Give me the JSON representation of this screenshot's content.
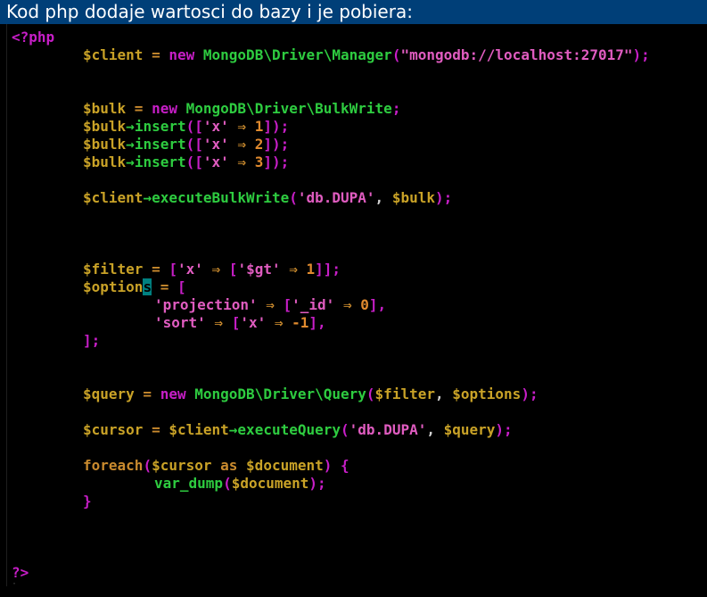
{
  "window": {
    "title": "Kod php dodaje wartosci do bazy i je pobiera:"
  },
  "colors": {
    "title_bar_bg": "#003f78",
    "editor_bg": "#000000",
    "variable": "#c9a227",
    "keyword": "#c71ec7",
    "class_name": "#2ecc40",
    "method": "#2ecc40",
    "string": "#e05cc0",
    "number": "#e08a2e",
    "operator": "#c98a2e",
    "punctuation": "#c71ec7",
    "arrow": "#2ecc40",
    "default": "#d0d0d0",
    "cursor": "#008080"
  },
  "cursor": {
    "line": 13,
    "char": "s"
  },
  "code_lines": [
    {
      "row": 0,
      "indent": 0,
      "tokens": [
        {
          "text": "<?php",
          "kind": "keyword"
        }
      ]
    },
    {
      "row": 1,
      "indent": 8,
      "tokens": [
        {
          "text": "$client",
          "kind": "variable"
        },
        {
          "text": " = ",
          "kind": "operator"
        },
        {
          "text": "new",
          "kind": "keyword"
        },
        {
          "text": " ",
          "kind": "default"
        },
        {
          "text": "MongoDB\\Driver\\Manager",
          "kind": "class_name"
        },
        {
          "text": "(",
          "kind": "punctuation"
        },
        {
          "text": "\"mongodb://localhost:27017\"",
          "kind": "string"
        },
        {
          "text": ");",
          "kind": "punctuation"
        }
      ]
    },
    {
      "row": 4,
      "indent": 8,
      "tokens": [
        {
          "text": "$bulk",
          "kind": "variable"
        },
        {
          "text": " = ",
          "kind": "operator"
        },
        {
          "text": "new",
          "kind": "keyword"
        },
        {
          "text": " ",
          "kind": "default"
        },
        {
          "text": "MongoDB\\Driver\\BulkWrite",
          "kind": "class_name"
        },
        {
          "text": ";",
          "kind": "punctuation"
        }
      ]
    },
    {
      "row": 5,
      "indent": 8,
      "tokens": [
        {
          "text": "$bulk",
          "kind": "variable"
        },
        {
          "text": "→",
          "kind": "arrow"
        },
        {
          "text": "insert",
          "kind": "method"
        },
        {
          "text": "([",
          "kind": "punctuation"
        },
        {
          "text": "'x'",
          "kind": "string"
        },
        {
          "text": " ⇒ ",
          "kind": "operator"
        },
        {
          "text": "1",
          "kind": "number"
        },
        {
          "text": "]);",
          "kind": "punctuation"
        }
      ]
    },
    {
      "row": 6,
      "indent": 8,
      "tokens": [
        {
          "text": "$bulk",
          "kind": "variable"
        },
        {
          "text": "→",
          "kind": "arrow"
        },
        {
          "text": "insert",
          "kind": "method"
        },
        {
          "text": "([",
          "kind": "punctuation"
        },
        {
          "text": "'x'",
          "kind": "string"
        },
        {
          "text": " ⇒ ",
          "kind": "operator"
        },
        {
          "text": "2",
          "kind": "number"
        },
        {
          "text": "]);",
          "kind": "punctuation"
        }
      ]
    },
    {
      "row": 7,
      "indent": 8,
      "tokens": [
        {
          "text": "$bulk",
          "kind": "variable"
        },
        {
          "text": "→",
          "kind": "arrow"
        },
        {
          "text": "insert",
          "kind": "method"
        },
        {
          "text": "([",
          "kind": "punctuation"
        },
        {
          "text": "'x'",
          "kind": "string"
        },
        {
          "text": " ⇒ ",
          "kind": "operator"
        },
        {
          "text": "3",
          "kind": "number"
        },
        {
          "text": "]);",
          "kind": "punctuation"
        }
      ]
    },
    {
      "row": 9,
      "indent": 8,
      "tokens": [
        {
          "text": "$client",
          "kind": "variable"
        },
        {
          "text": "→",
          "kind": "arrow"
        },
        {
          "text": "executeBulkWrite",
          "kind": "method"
        },
        {
          "text": "(",
          "kind": "punctuation"
        },
        {
          "text": "'db.DUPA'",
          "kind": "string"
        },
        {
          "text": ", ",
          "kind": "default"
        },
        {
          "text": "$bulk",
          "kind": "variable"
        },
        {
          "text": ");",
          "kind": "punctuation"
        }
      ]
    },
    {
      "row": 13,
      "indent": 8,
      "tokens": [
        {
          "text": "$filter",
          "kind": "variable"
        },
        {
          "text": " = ",
          "kind": "operator"
        },
        {
          "text": "[",
          "kind": "punctuation"
        },
        {
          "text": "'x'",
          "kind": "string"
        },
        {
          "text": " ⇒ ",
          "kind": "operator"
        },
        {
          "text": "[",
          "kind": "punctuation"
        },
        {
          "text": "'$gt'",
          "kind": "string"
        },
        {
          "text": " ⇒ ",
          "kind": "operator"
        },
        {
          "text": "1",
          "kind": "number"
        },
        {
          "text": "]];",
          "kind": "punctuation"
        }
      ]
    },
    {
      "row": 14,
      "indent": 8,
      "tokens": [
        {
          "text": "$option",
          "kind": "variable"
        },
        {
          "text": "s",
          "kind": "cursor"
        },
        {
          "text": " = ",
          "kind": "operator"
        },
        {
          "text": "[",
          "kind": "punctuation"
        }
      ]
    },
    {
      "row": 15,
      "indent": 16,
      "tokens": [
        {
          "text": "'projection'",
          "kind": "string"
        },
        {
          "text": " ⇒ ",
          "kind": "operator"
        },
        {
          "text": "[",
          "kind": "punctuation"
        },
        {
          "text": "'_id'",
          "kind": "string"
        },
        {
          "text": " ⇒ ",
          "kind": "operator"
        },
        {
          "text": "0",
          "kind": "number"
        },
        {
          "text": "],",
          "kind": "punctuation"
        }
      ]
    },
    {
      "row": 16,
      "indent": 16,
      "tokens": [
        {
          "text": "'sort'",
          "kind": "string"
        },
        {
          "text": " ⇒ ",
          "kind": "operator"
        },
        {
          "text": "[",
          "kind": "punctuation"
        },
        {
          "text": "'x'",
          "kind": "string"
        },
        {
          "text": " ⇒ ",
          "kind": "operator"
        },
        {
          "text": "-1",
          "kind": "number"
        },
        {
          "text": "],",
          "kind": "punctuation"
        }
      ]
    },
    {
      "row": 17,
      "indent": 8,
      "tokens": [
        {
          "text": "];",
          "kind": "punctuation"
        }
      ]
    },
    {
      "row": 20,
      "indent": 8,
      "tokens": [
        {
          "text": "$query",
          "kind": "variable"
        },
        {
          "text": " = ",
          "kind": "operator"
        },
        {
          "text": "new",
          "kind": "keyword"
        },
        {
          "text": " ",
          "kind": "default"
        },
        {
          "text": "MongoDB\\Driver\\Query",
          "kind": "class_name"
        },
        {
          "text": "(",
          "kind": "punctuation"
        },
        {
          "text": "$filter",
          "kind": "variable"
        },
        {
          "text": ", ",
          "kind": "default"
        },
        {
          "text": "$options",
          "kind": "variable"
        },
        {
          "text": ");",
          "kind": "punctuation"
        }
      ]
    },
    {
      "row": 22,
      "indent": 8,
      "tokens": [
        {
          "text": "$cursor",
          "kind": "variable"
        },
        {
          "text": " = ",
          "kind": "operator"
        },
        {
          "text": "$client",
          "kind": "variable"
        },
        {
          "text": "→",
          "kind": "arrow"
        },
        {
          "text": "executeQuery",
          "kind": "method"
        },
        {
          "text": "(",
          "kind": "punctuation"
        },
        {
          "text": "'db.DUPA'",
          "kind": "string"
        },
        {
          "text": ", ",
          "kind": "default"
        },
        {
          "text": "$query",
          "kind": "variable"
        },
        {
          "text": ");",
          "kind": "punctuation"
        }
      ]
    },
    {
      "row": 24,
      "indent": 8,
      "tokens": [
        {
          "text": "foreach",
          "kind": "operator"
        },
        {
          "text": "(",
          "kind": "punctuation"
        },
        {
          "text": "$cursor",
          "kind": "variable"
        },
        {
          "text": " as ",
          "kind": "operator"
        },
        {
          "text": "$document",
          "kind": "variable"
        },
        {
          "text": ")",
          "kind": "punctuation"
        },
        {
          "text": " {",
          "kind": "punctuation"
        }
      ]
    },
    {
      "row": 25,
      "indent": 16,
      "tokens": [
        {
          "text": "var_dump",
          "kind": "method"
        },
        {
          "text": "(",
          "kind": "punctuation"
        },
        {
          "text": "$document",
          "kind": "variable"
        },
        {
          "text": ");",
          "kind": "punctuation"
        }
      ]
    },
    {
      "row": 26,
      "indent": 8,
      "tokens": [
        {
          "text": "}",
          "kind": "punctuation"
        }
      ]
    },
    {
      "row": 30,
      "indent": 0,
      "tokens": [
        {
          "text": "?>",
          "kind": "keyword"
        }
      ]
    }
  ]
}
